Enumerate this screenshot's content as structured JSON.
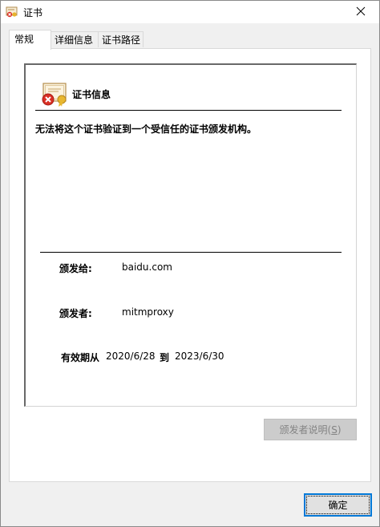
{
  "window": {
    "title": "证书"
  },
  "tabs": [
    {
      "label": "常规",
      "active": true
    },
    {
      "label": "详细信息",
      "active": false
    },
    {
      "label": "证书路径",
      "active": false
    }
  ],
  "cert": {
    "heading": "证书信息",
    "warning": "无法将这个证书验证到一个受信任的证书颁发机构。",
    "issued_to_label": "颁发给:",
    "issued_to_value": "baidu.com",
    "issued_by_label": "颁发者:",
    "issued_by_value": "mitmproxy",
    "validity_label": "有效期从",
    "valid_from": "2020/6/28",
    "to_label": "到",
    "valid_to": "2023/6/30"
  },
  "buttons": {
    "issuer_statement_label": "颁发者说明(",
    "issuer_statement_key": "S",
    "issuer_statement_suffix": ")",
    "ok_label": "确定"
  },
  "icons": {
    "title": "certificate-icon",
    "close": "close-icon",
    "cert_error": "certificate-error-icon"
  },
  "colors": {
    "focus_border": "#0078d7",
    "error_red": "#d93025",
    "disabled_bg": "#cccccc"
  }
}
